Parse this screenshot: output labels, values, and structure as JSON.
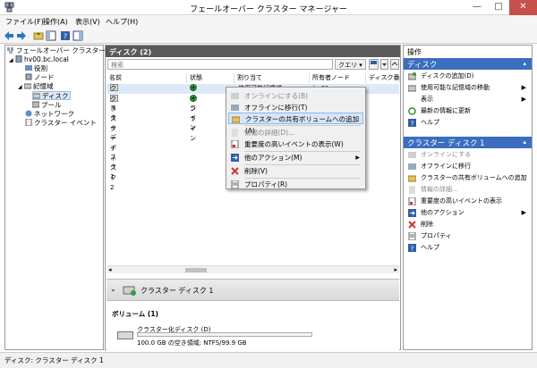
{
  "window": {
    "title": "フェールオーバー クラスター マネージャー",
    "min": "—",
    "max": "□",
    "close": "✕"
  },
  "menu": [
    "ファイル(F)",
    "操作(A)",
    "表示(V)",
    "ヘルプ(H)"
  ],
  "tree": {
    "root": "フェールオーバー クラスター マネージ",
    "cluster": "hv00.bc.local",
    "roles": "役割",
    "nodes": "ノード",
    "storage": "記憶域",
    "disks": "ディスク",
    "pools": "プール",
    "network": "ネットワーク",
    "events": "クラスター イベント"
  },
  "center": {
    "header": "ディスク (2)",
    "search_placeholder": "検索",
    "query_button": "クエリ ▾",
    "columns": [
      "名前",
      "状態",
      "割り当て",
      "所有者ノード",
      "ディスク番号"
    ],
    "rows": [
      {
        "name": "クラスター ディスク 1",
        "status": "オンライン",
        "assigned": "使用可能記憶域",
        "owner": "hv01"
      },
      {
        "name": "クラスター ディスク 2",
        "status": "オンライン",
        "assigned": "",
        "owner": ""
      }
    ],
    "detail_title": "クラスター ディスク 1",
    "volume_header": "ボリューム (1)",
    "volume_name": "クラスター化ディスク (D)",
    "volume_info": "100.0 GB の空き領域: NTFS/99.9 GB"
  },
  "context_menu": [
    {
      "label": "オンラインにする(B)",
      "disabled": true
    },
    {
      "label": "オフラインに移行(T)",
      "disabled": false
    },
    {
      "label": "クラスターの共有ボリュームへの追加(A)",
      "disabled": false,
      "hover": true
    },
    {
      "label": "情報の詳細(D)...",
      "disabled": true
    },
    {
      "label": "重要度の高いイベントの表示(W)",
      "disabled": false
    },
    {
      "label": "他のアクション(M)",
      "disabled": false,
      "submenu": true
    },
    {
      "label": "削除(V)",
      "disabled": false
    },
    {
      "label": "プロパティ(R)",
      "disabled": false
    }
  ],
  "actions": {
    "header": "操作",
    "section1": "ディスク",
    "items1": [
      "ディスクの追加(D)",
      "使用可能な記憶域の移動",
      "表示",
      "最新の情報に更新",
      "ヘルプ"
    ],
    "section2": "クラスター ディスク 1",
    "items2": [
      "オンラインにする",
      "オフラインに移行",
      "クラスターの共有ボリュームへの追加",
      "情報の詳細...",
      "重要度の高いイベントの表示",
      "他のアクション",
      "削除",
      "プロパティ",
      "ヘルプ"
    ]
  },
  "status": "ディスク:  クラスター ディスク 1",
  "colors": {
    "accent": "#3c6ebf",
    "header": "#5a5a5a",
    "online": "#3c9b3c"
  }
}
